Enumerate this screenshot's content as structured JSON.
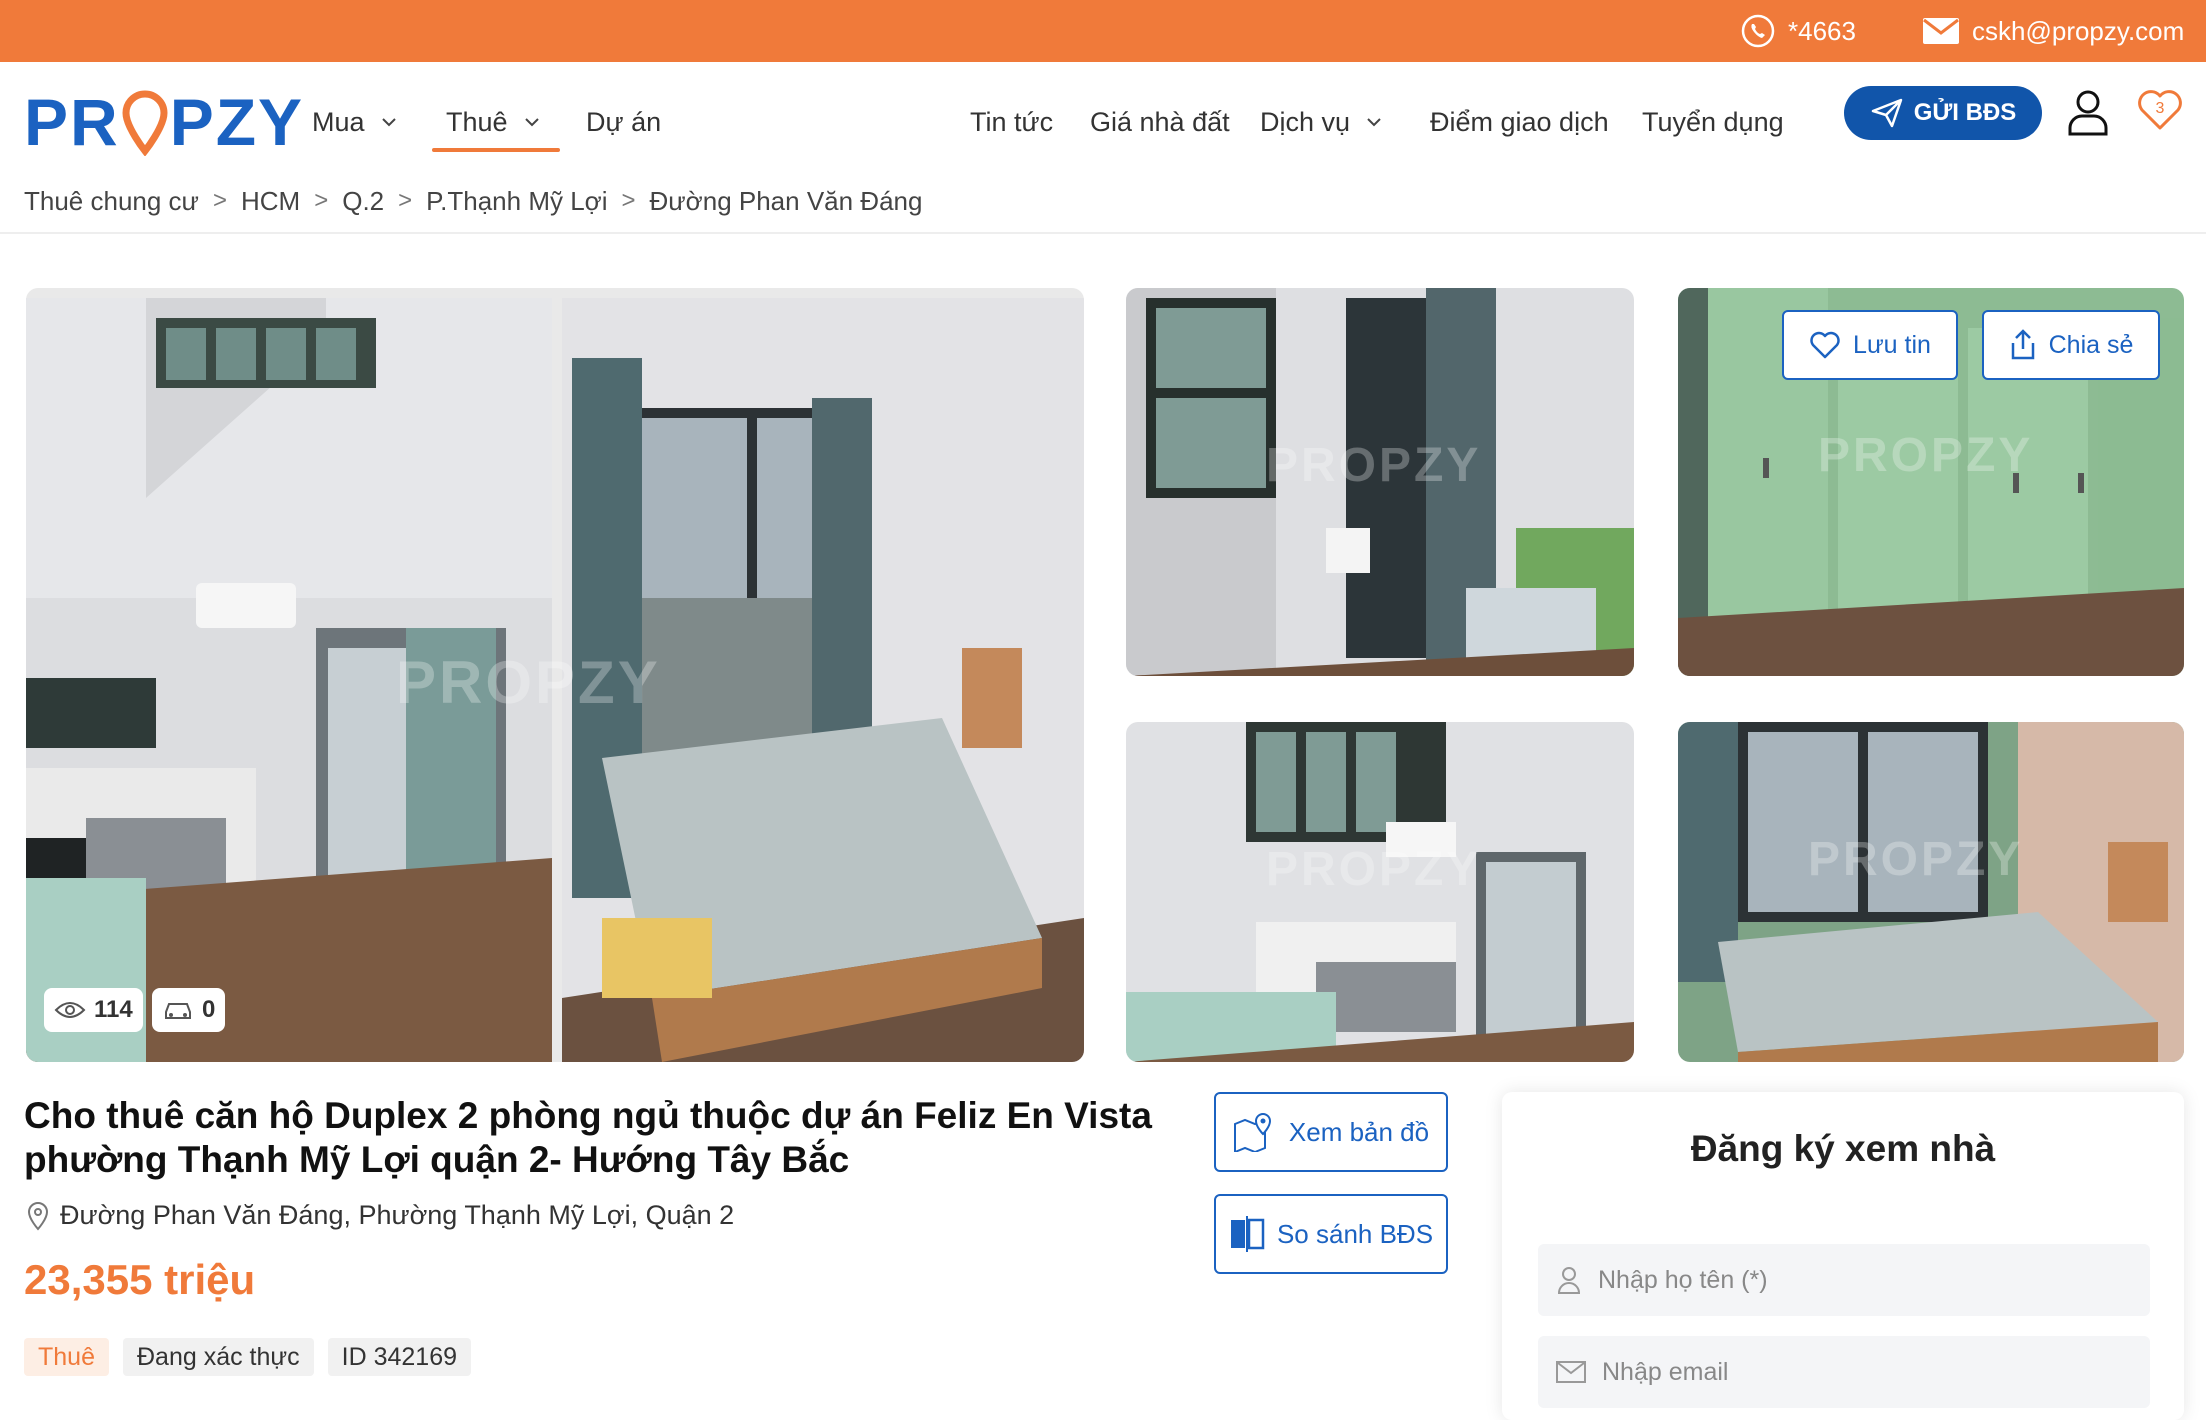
{
  "topbar": {
    "phone": "*4663",
    "email": "cskh@propzy.com",
    "phone_icon": "whatsapp-phone-icon",
    "email_icon": "envelope-icon",
    "bg_color": "#f07a3a"
  },
  "header": {
    "logo_left": "PR",
    "logo_right": "PZY",
    "nav": [
      {
        "label": "Mua",
        "has_dropdown": true
      },
      {
        "label": "Thuê",
        "has_dropdown": true,
        "active": true
      },
      {
        "label": "Dự án",
        "has_dropdown": false
      },
      {
        "label": "Tin tức",
        "has_dropdown": false
      },
      {
        "label": "Giá nhà đất",
        "has_dropdown": false
      },
      {
        "label": "Dịch vụ",
        "has_dropdown": true
      },
      {
        "label": "Điểm giao dịch",
        "has_dropdown": false
      },
      {
        "label": "Tuyển dụng",
        "has_dropdown": false
      }
    ],
    "send_button": "GỬI BĐS",
    "favorites_count": "3",
    "accent_color": "#f07a3a",
    "brand_color": "#1b62c1"
  },
  "breadcrumb": [
    "Thuê chung cư",
    "HCM",
    "Q.2",
    "P.Thạnh Mỹ Lợi",
    "Đường Phan Văn Đáng"
  ],
  "gallery": {
    "views": "114",
    "cars": "0",
    "watermark": "PROPZY",
    "save_label": "Lưu tin",
    "share_label": "Chia sẻ"
  },
  "listing": {
    "title_line1": "Cho thuê căn hộ Duplex 2 phòng ngủ thuộc dự án Feliz En Vista",
    "title_line2": "phường Thạnh Mỹ Lợi quận 2- Hướng Tây Bắc",
    "address": "Đường Phan Văn Đáng, Phường Thạnh Mỹ Lợi, Quận 2",
    "price": "23,355 triệu",
    "tags": [
      "Thuê",
      "Đang xác thực",
      "ID 342169"
    ],
    "map_button": "Xem bản đồ",
    "compare_button": "So sánh BĐS"
  },
  "register": {
    "title": "Đăng ký xem nhà",
    "name_placeholder": "Nhập họ tên (*)",
    "email_placeholder": "Nhập email"
  }
}
